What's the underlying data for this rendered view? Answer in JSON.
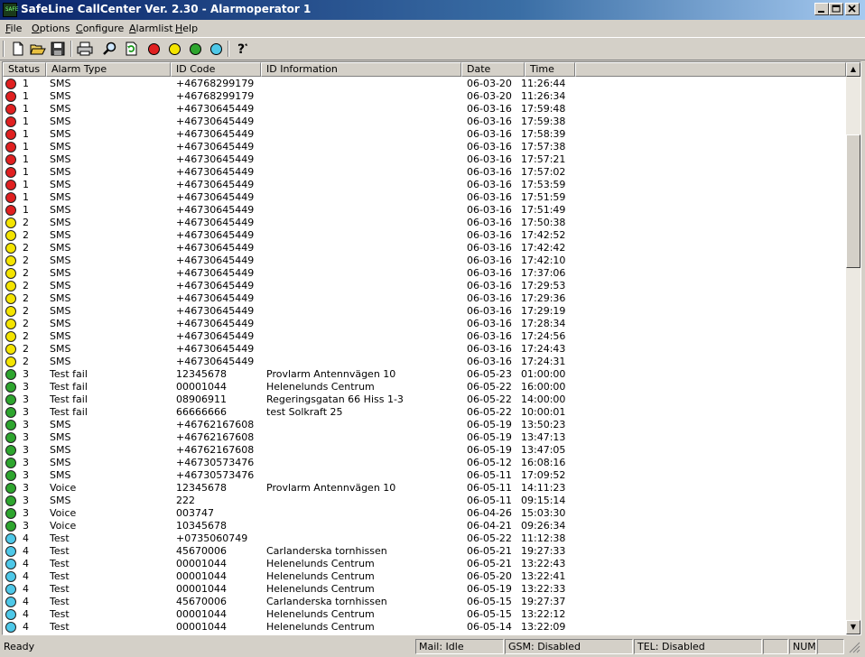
{
  "window": {
    "title": "SafeLine CallCenter Ver. 2.30 - Alarmoperator 1",
    "icon_label": "SAFE",
    "controls": [
      "minimize-icon",
      "maximize-icon",
      "close-icon"
    ]
  },
  "menu": [
    {
      "label": "File",
      "accel": "F",
      "rest": "ile"
    },
    {
      "label": "Options",
      "accel": "O",
      "rest": "ptions"
    },
    {
      "label": "Configure",
      "accel": "C",
      "rest": "onfigure"
    },
    {
      "label": "Alarmlist",
      "accel": "A",
      "rest": "larmlist"
    },
    {
      "label": "Help",
      "accel": "H",
      "rest": "elp"
    }
  ],
  "toolbar": {
    "icons": [
      "new-document-icon",
      "open-folder-icon",
      "save-icon",
      "print-icon",
      "find-icon",
      "refresh-icon",
      "red-status-icon",
      "yellow-status-icon",
      "green-status-icon",
      "blue-status-icon",
      "help-icon"
    ],
    "status_colors": {
      "red": "#e02020",
      "yellow": "#f4e400",
      "green": "#2ea52e",
      "blue": "#4ec8e8"
    }
  },
  "list": {
    "columns": [
      "Status",
      "Alarm Type",
      "ID Code",
      "ID Information",
      "Date",
      "Time"
    ],
    "rows": [
      {
        "color": "#e02020",
        "status": "1",
        "type": "SMS",
        "id": "+46768299179",
        "info": "",
        "date": "06-03-20",
        "time": "11:26:44"
      },
      {
        "color": "#e02020",
        "status": "1",
        "type": "SMS",
        "id": "+46768299179",
        "info": "",
        "date": "06-03-20",
        "time": "11:26:34"
      },
      {
        "color": "#e02020",
        "status": "1",
        "type": "SMS",
        "id": "+46730645449",
        "info": "",
        "date": "06-03-16",
        "time": "17:59:48"
      },
      {
        "color": "#e02020",
        "status": "1",
        "type": "SMS",
        "id": "+46730645449",
        "info": "",
        "date": "06-03-16",
        "time": "17:59:38"
      },
      {
        "color": "#e02020",
        "status": "1",
        "type": "SMS",
        "id": "+46730645449",
        "info": "",
        "date": "06-03-16",
        "time": "17:58:39"
      },
      {
        "color": "#e02020",
        "status": "1",
        "type": "SMS",
        "id": "+46730645449",
        "info": "",
        "date": "06-03-16",
        "time": "17:57:38"
      },
      {
        "color": "#e02020",
        "status": "1",
        "type": "SMS",
        "id": "+46730645449",
        "info": "",
        "date": "06-03-16",
        "time": "17:57:21"
      },
      {
        "color": "#e02020",
        "status": "1",
        "type": "SMS",
        "id": "+46730645449",
        "info": "",
        "date": "06-03-16",
        "time": "17:57:02"
      },
      {
        "color": "#e02020",
        "status": "1",
        "type": "SMS",
        "id": "+46730645449",
        "info": "",
        "date": "06-03-16",
        "time": "17:53:59"
      },
      {
        "color": "#e02020",
        "status": "1",
        "type": "SMS",
        "id": "+46730645449",
        "info": "",
        "date": "06-03-16",
        "time": "17:51:59"
      },
      {
        "color": "#e02020",
        "status": "1",
        "type": "SMS",
        "id": "+46730645449",
        "info": "",
        "date": "06-03-16",
        "time": "17:51:49"
      },
      {
        "color": "#f4e400",
        "status": "2",
        "type": "SMS",
        "id": "+46730645449",
        "info": "",
        "date": "06-03-16",
        "time": "17:50:38"
      },
      {
        "color": "#f4e400",
        "status": "2",
        "type": "SMS",
        "id": "+46730645449",
        "info": "",
        "date": "06-03-16",
        "time": "17:42:52"
      },
      {
        "color": "#f4e400",
        "status": "2",
        "type": "SMS",
        "id": "+46730645449",
        "info": "",
        "date": "06-03-16",
        "time": "17:42:42"
      },
      {
        "color": "#f4e400",
        "status": "2",
        "type": "SMS",
        "id": "+46730645449",
        "info": "",
        "date": "06-03-16",
        "time": "17:42:10"
      },
      {
        "color": "#f4e400",
        "status": "2",
        "type": "SMS",
        "id": "+46730645449",
        "info": "",
        "date": "06-03-16",
        "time": "17:37:06"
      },
      {
        "color": "#f4e400",
        "status": "2",
        "type": "SMS",
        "id": "+46730645449",
        "info": "",
        "date": "06-03-16",
        "time": "17:29:53"
      },
      {
        "color": "#f4e400",
        "status": "2",
        "type": "SMS",
        "id": "+46730645449",
        "info": "",
        "date": "06-03-16",
        "time": "17:29:36"
      },
      {
        "color": "#f4e400",
        "status": "2",
        "type": "SMS",
        "id": "+46730645449",
        "info": "",
        "date": "06-03-16",
        "time": "17:29:19"
      },
      {
        "color": "#f4e400",
        "status": "2",
        "type": "SMS",
        "id": "+46730645449",
        "info": "",
        "date": "06-03-16",
        "time": "17:28:34"
      },
      {
        "color": "#f4e400",
        "status": "2",
        "type": "SMS",
        "id": "+46730645449",
        "info": "",
        "date": "06-03-16",
        "time": "17:24:56"
      },
      {
        "color": "#f4e400",
        "status": "2",
        "type": "SMS",
        "id": "+46730645449",
        "info": "",
        "date": "06-03-16",
        "time": "17:24:43"
      },
      {
        "color": "#f4e400",
        "status": "2",
        "type": "SMS",
        "id": "+46730645449",
        "info": "",
        "date": "06-03-16",
        "time": "17:24:31"
      },
      {
        "color": "#2ea52e",
        "status": "3",
        "type": "Test fail",
        "id": "12345678",
        "info": "Provlarm Antennvägen 10",
        "date": "06-05-23",
        "time": "01:00:00"
      },
      {
        "color": "#2ea52e",
        "status": "3",
        "type": "Test fail",
        "id": "00001044",
        "info": "Helenelunds Centrum",
        "date": "06-05-22",
        "time": "16:00:00"
      },
      {
        "color": "#2ea52e",
        "status": "3",
        "type": "Test fail",
        "id": "08906911",
        "info": "Regeringsgatan 66 Hiss 1-3",
        "date": "06-05-22",
        "time": "14:00:00"
      },
      {
        "color": "#2ea52e",
        "status": "3",
        "type": "Test fail",
        "id": "66666666",
        "info": "test Solkraft 25",
        "date": "06-05-22",
        "time": "10:00:01"
      },
      {
        "color": "#2ea52e",
        "status": "3",
        "type": "SMS",
        "id": "+46762167608",
        "info": "",
        "date": "06-05-19",
        "time": "13:50:23"
      },
      {
        "color": "#2ea52e",
        "status": "3",
        "type": "SMS",
        "id": "+46762167608",
        "info": "",
        "date": "06-05-19",
        "time": "13:47:13"
      },
      {
        "color": "#2ea52e",
        "status": "3",
        "type": "SMS",
        "id": "+46762167608",
        "info": "",
        "date": "06-05-19",
        "time": "13:47:05"
      },
      {
        "color": "#2ea52e",
        "status": "3",
        "type": "SMS",
        "id": "+46730573476",
        "info": "",
        "date": "06-05-12",
        "time": "16:08:16"
      },
      {
        "color": "#2ea52e",
        "status": "3",
        "type": "SMS",
        "id": "+46730573476",
        "info": "",
        "date": "06-05-11",
        "time": "17:09:52"
      },
      {
        "color": "#2ea52e",
        "status": "3",
        "type": "Voice",
        "id": "12345678",
        "info": "Provlarm Antennvägen 10",
        "date": "06-05-11",
        "time": "14:11:23"
      },
      {
        "color": "#2ea52e",
        "status": "3",
        "type": "SMS",
        "id": "222",
        "info": "",
        "date": "06-05-11",
        "time": "09:15:14"
      },
      {
        "color": "#2ea52e",
        "status": "3",
        "type": "Voice",
        "id": "003747",
        "info": "",
        "date": "06-04-26",
        "time": "15:03:30"
      },
      {
        "color": "#2ea52e",
        "status": "3",
        "type": "Voice",
        "id": "10345678",
        "info": "",
        "date": "06-04-21",
        "time": "09:26:34"
      },
      {
        "color": "#4ec8e8",
        "status": "4",
        "type": "Test",
        "id": "+0735060749",
        "info": "",
        "date": "06-05-22",
        "time": "11:12:38"
      },
      {
        "color": "#4ec8e8",
        "status": "4",
        "type": "Test",
        "id": "45670006",
        "info": "Carlanderska tornhissen",
        "date": "06-05-21",
        "time": "19:27:33"
      },
      {
        "color": "#4ec8e8",
        "status": "4",
        "type": "Test",
        "id": "00001044",
        "info": "Helenelunds Centrum",
        "date": "06-05-21",
        "time": "13:22:43"
      },
      {
        "color": "#4ec8e8",
        "status": "4",
        "type": "Test",
        "id": "00001044",
        "info": "Helenelunds Centrum",
        "date": "06-05-20",
        "time": "13:22:41"
      },
      {
        "color": "#4ec8e8",
        "status": "4",
        "type": "Test",
        "id": "00001044",
        "info": "Helenelunds Centrum",
        "date": "06-05-19",
        "time": "13:22:33"
      },
      {
        "color": "#4ec8e8",
        "status": "4",
        "type": "Test",
        "id": "45670006",
        "info": "Carlanderska tornhissen",
        "date": "06-05-15",
        "time": "19:27:37"
      },
      {
        "color": "#4ec8e8",
        "status": "4",
        "type": "Test",
        "id": "00001044",
        "info": "Helenelunds Centrum",
        "date": "06-05-15",
        "time": "13:22:12"
      },
      {
        "color": "#4ec8e8",
        "status": "4",
        "type": "Test",
        "id": "00001044",
        "info": "Helenelunds Centrum",
        "date": "06-05-14",
        "time": "13:22:09"
      }
    ]
  },
  "statusbar": {
    "ready": "Ready",
    "mail": "Mail: Idle",
    "gsm": "GSM: Disabled",
    "tel": "TEL: Disabled",
    "num": "NUM"
  }
}
